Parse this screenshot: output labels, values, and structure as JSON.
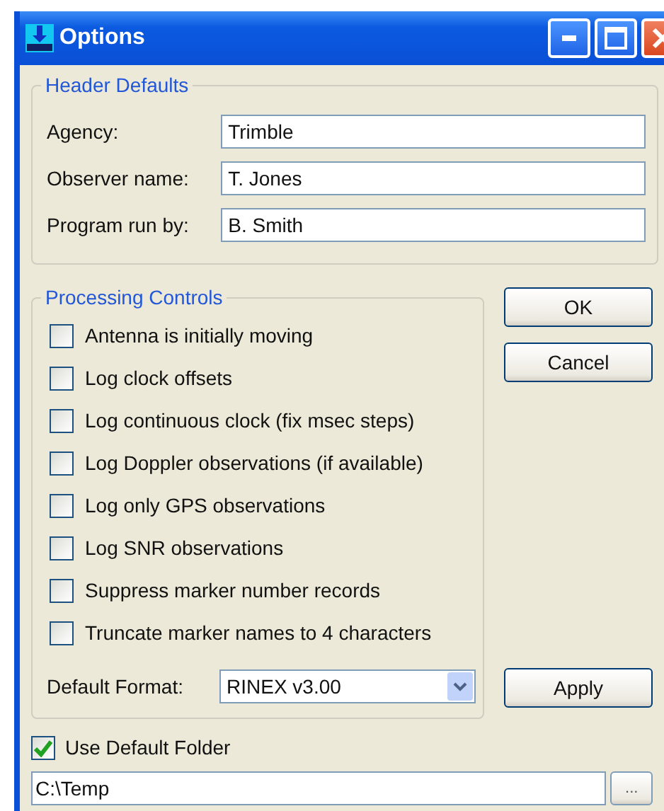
{
  "window": {
    "title": "Options"
  },
  "header_defaults": {
    "title": "Header Defaults",
    "fields": [
      {
        "label": "Agency:",
        "value": "Trimble"
      },
      {
        "label": "Observer name:",
        "value": "T. Jones"
      },
      {
        "label": "Program run by:",
        "value": "B. Smith"
      }
    ]
  },
  "processing_controls": {
    "title": "Processing Controls",
    "options": [
      {
        "label": "Antenna is initially moving",
        "checked": false
      },
      {
        "label": "Log clock offsets",
        "checked": false
      },
      {
        "label": "Log continuous clock (fix msec steps)",
        "checked": false
      },
      {
        "label": "Log Doppler observations (if available)",
        "checked": false
      },
      {
        "label": "Log only GPS observations",
        "checked": false
      },
      {
        "label": "Log SNR observations",
        "checked": false
      },
      {
        "label": "Suppress marker number records",
        "checked": false
      },
      {
        "label": "Truncate marker names to 4 characters",
        "checked": false
      }
    ],
    "format": {
      "label": "Default Format:",
      "value": "RINEX v3.00"
    }
  },
  "buttons": [
    "OK",
    "Cancel",
    "Apply"
  ],
  "default_folder": {
    "label": "Use Default Folder",
    "checked": true,
    "path": "C:\\Temp",
    "browse": "..."
  }
}
